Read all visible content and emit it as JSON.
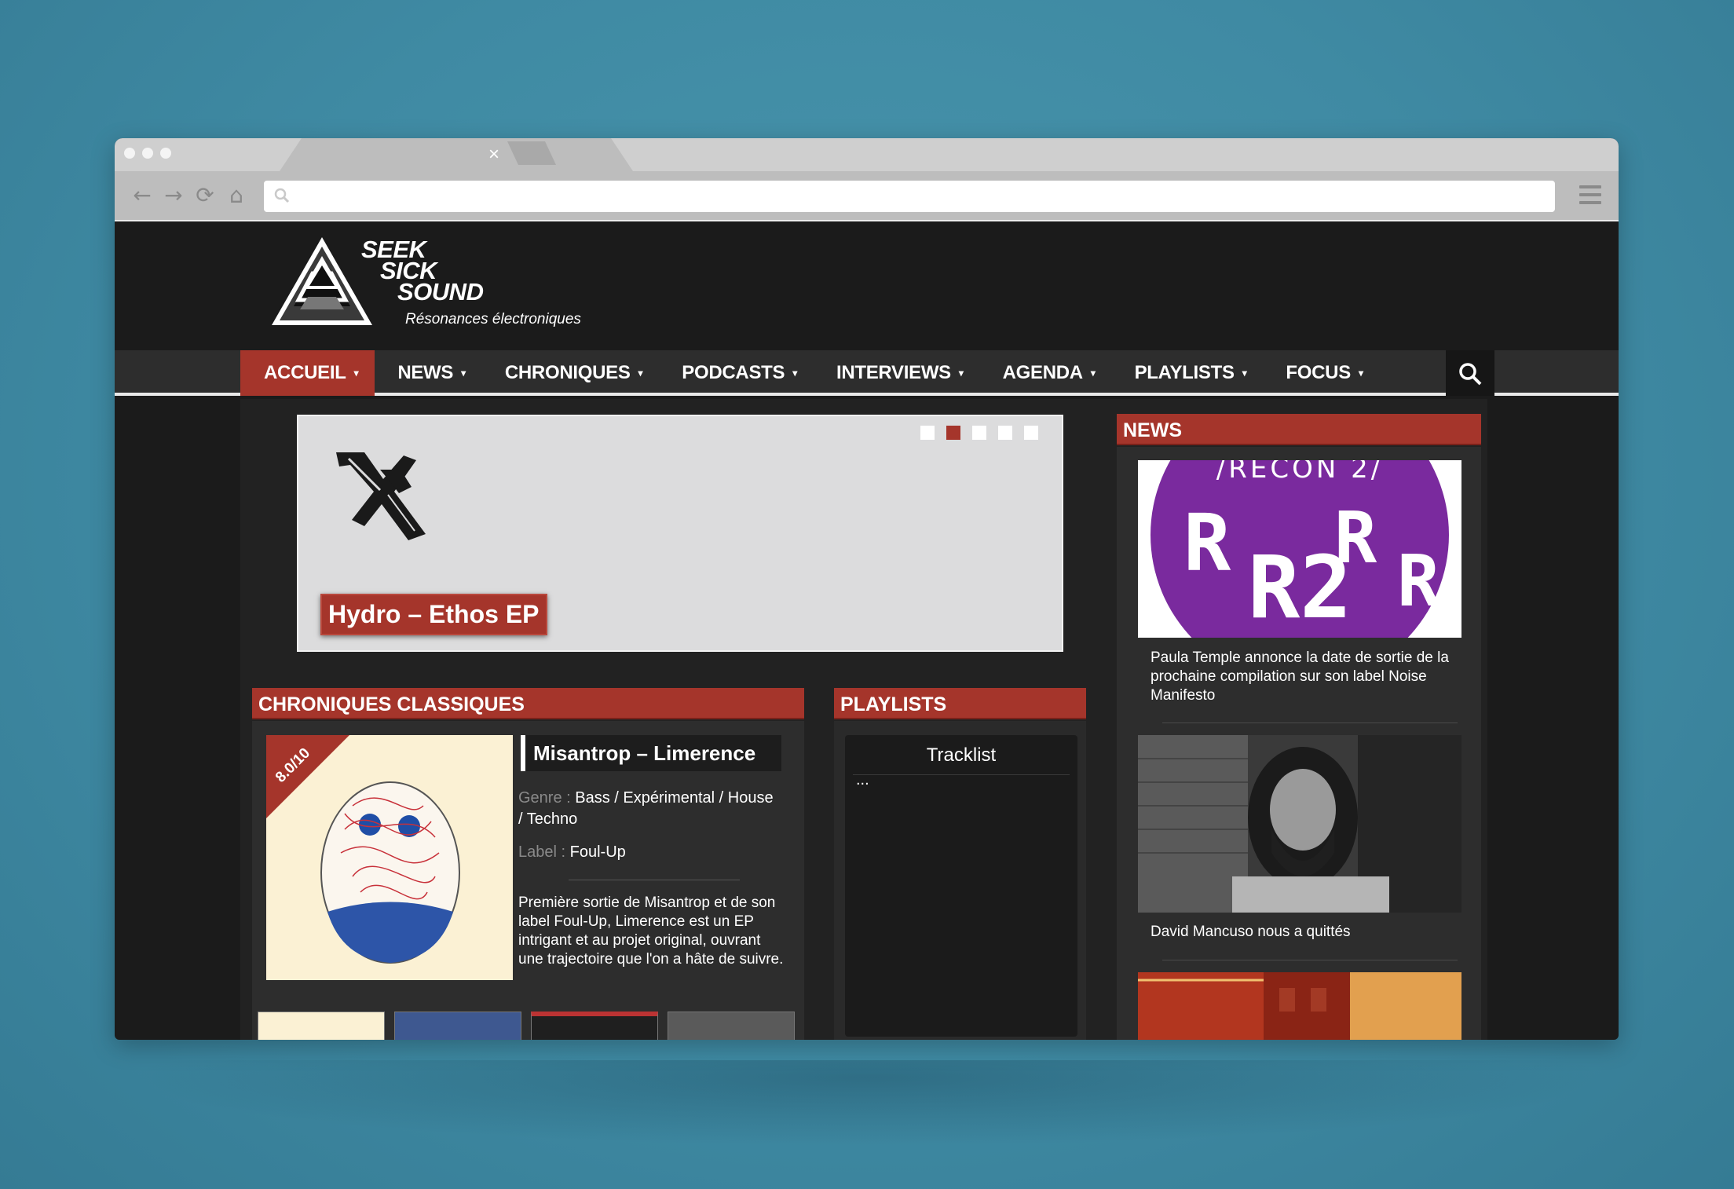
{
  "browser": {
    "tab_close": "×"
  },
  "site": {
    "logo_lines": [
      "SEEK",
      "SICK",
      "SOUND"
    ],
    "tagline": "Résonances électroniques"
  },
  "nav": {
    "items": [
      {
        "label": "ACCUEIL",
        "active": true
      },
      {
        "label": "NEWS",
        "active": false
      },
      {
        "label": "CHRONIQUES",
        "active": false
      },
      {
        "label": "PODCASTS",
        "active": false
      },
      {
        "label": "INTERVIEWS",
        "active": false
      },
      {
        "label": "AGENDA",
        "active": false
      },
      {
        "label": "PLAYLISTS",
        "active": false
      },
      {
        "label": "FOCUS",
        "active": false
      }
    ],
    "caret": "▾"
  },
  "slider": {
    "title": "Hydro – Ethos EP",
    "dot_count": 5,
    "active_dot": 2
  },
  "chroniques": {
    "heading": "CHRONIQUES CLASSIQUES",
    "score": "8.0/10",
    "title": "Misantrop – Limerence",
    "genre_key": "Genre :",
    "genre_value": "Bass / Expérimental  / House",
    "genre_value_2": "/ Techno",
    "label_key": "Label :",
    "label_value": "Foul-Up",
    "description": "Première sortie de Misantrop et de son label Foul-Up, Limerence est un EP intrigant et au projet original, ouvrant une trajectoire que l'on a hâte de suivre."
  },
  "playlists": {
    "heading": "PLAYLISTS",
    "title": "Tracklist",
    "content": "..."
  },
  "news": {
    "heading": "NEWS",
    "items": [
      {
        "text": "Paula Temple annonce la date de sortie de la prochaine compilation sur son label Noise Manifesto",
        "image_text": "/RECON 2/"
      },
      {
        "text": "David Mancuso nous a quittés"
      },
      {
        "text": ""
      }
    ]
  },
  "colors": {
    "accent": "#a5352b",
    "background": "#1b1b1b",
    "panel": "#2d2d2d"
  }
}
